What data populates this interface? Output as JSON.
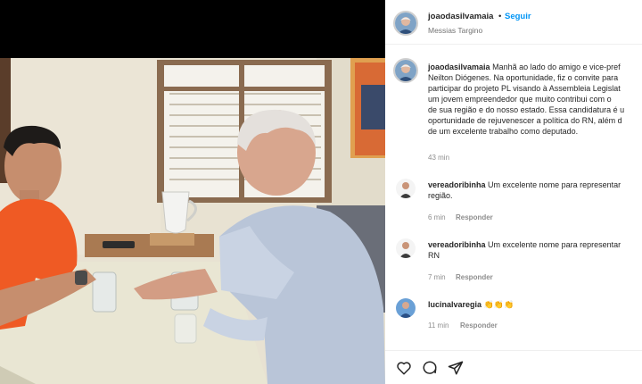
{
  "header": {
    "username": "joaodasilvamaia",
    "separator": "•",
    "follow_label": "Seguir",
    "location": "Messias Targino"
  },
  "caption": {
    "username": "joaodasilvamaia",
    "lines": [
      "Manhã ao lado do amigo e vice-pref",
      "Neilton Diógenes. Na oportunidade, fiz o convite para",
      "participar do projeto PL visando à Assembleia Legislat",
      "um jovem empreendedor que muito contribui com o",
      "de sua região e do nosso estado. Essa candidatura é u",
      "oportunidade de rejuvenescer a política do RN, além d",
      "de um excelente trabalho como deputado."
    ],
    "time": "43 min"
  },
  "comments": [
    {
      "username": "vereadoribinha",
      "line1": "Um excelente nome para representar",
      "line2": "região.",
      "time": "6 min",
      "reply": "Responder"
    },
    {
      "username": "vereadoribinha",
      "line1": "Um excelente nome para representar",
      "line2": "RN",
      "time": "7 min",
      "reply": "Responder"
    },
    {
      "username": "lucinalvaregia",
      "line1": "👏👏👏",
      "time": "11 min",
      "reply": "Responder"
    }
  ],
  "actions": {
    "like_icon": "heart-icon",
    "comment_icon": "comment-icon",
    "share_icon": "share-icon"
  },
  "colors": {
    "link_blue": "#0095f6",
    "meta_gray": "#8e8e8e",
    "text": "#262626"
  }
}
